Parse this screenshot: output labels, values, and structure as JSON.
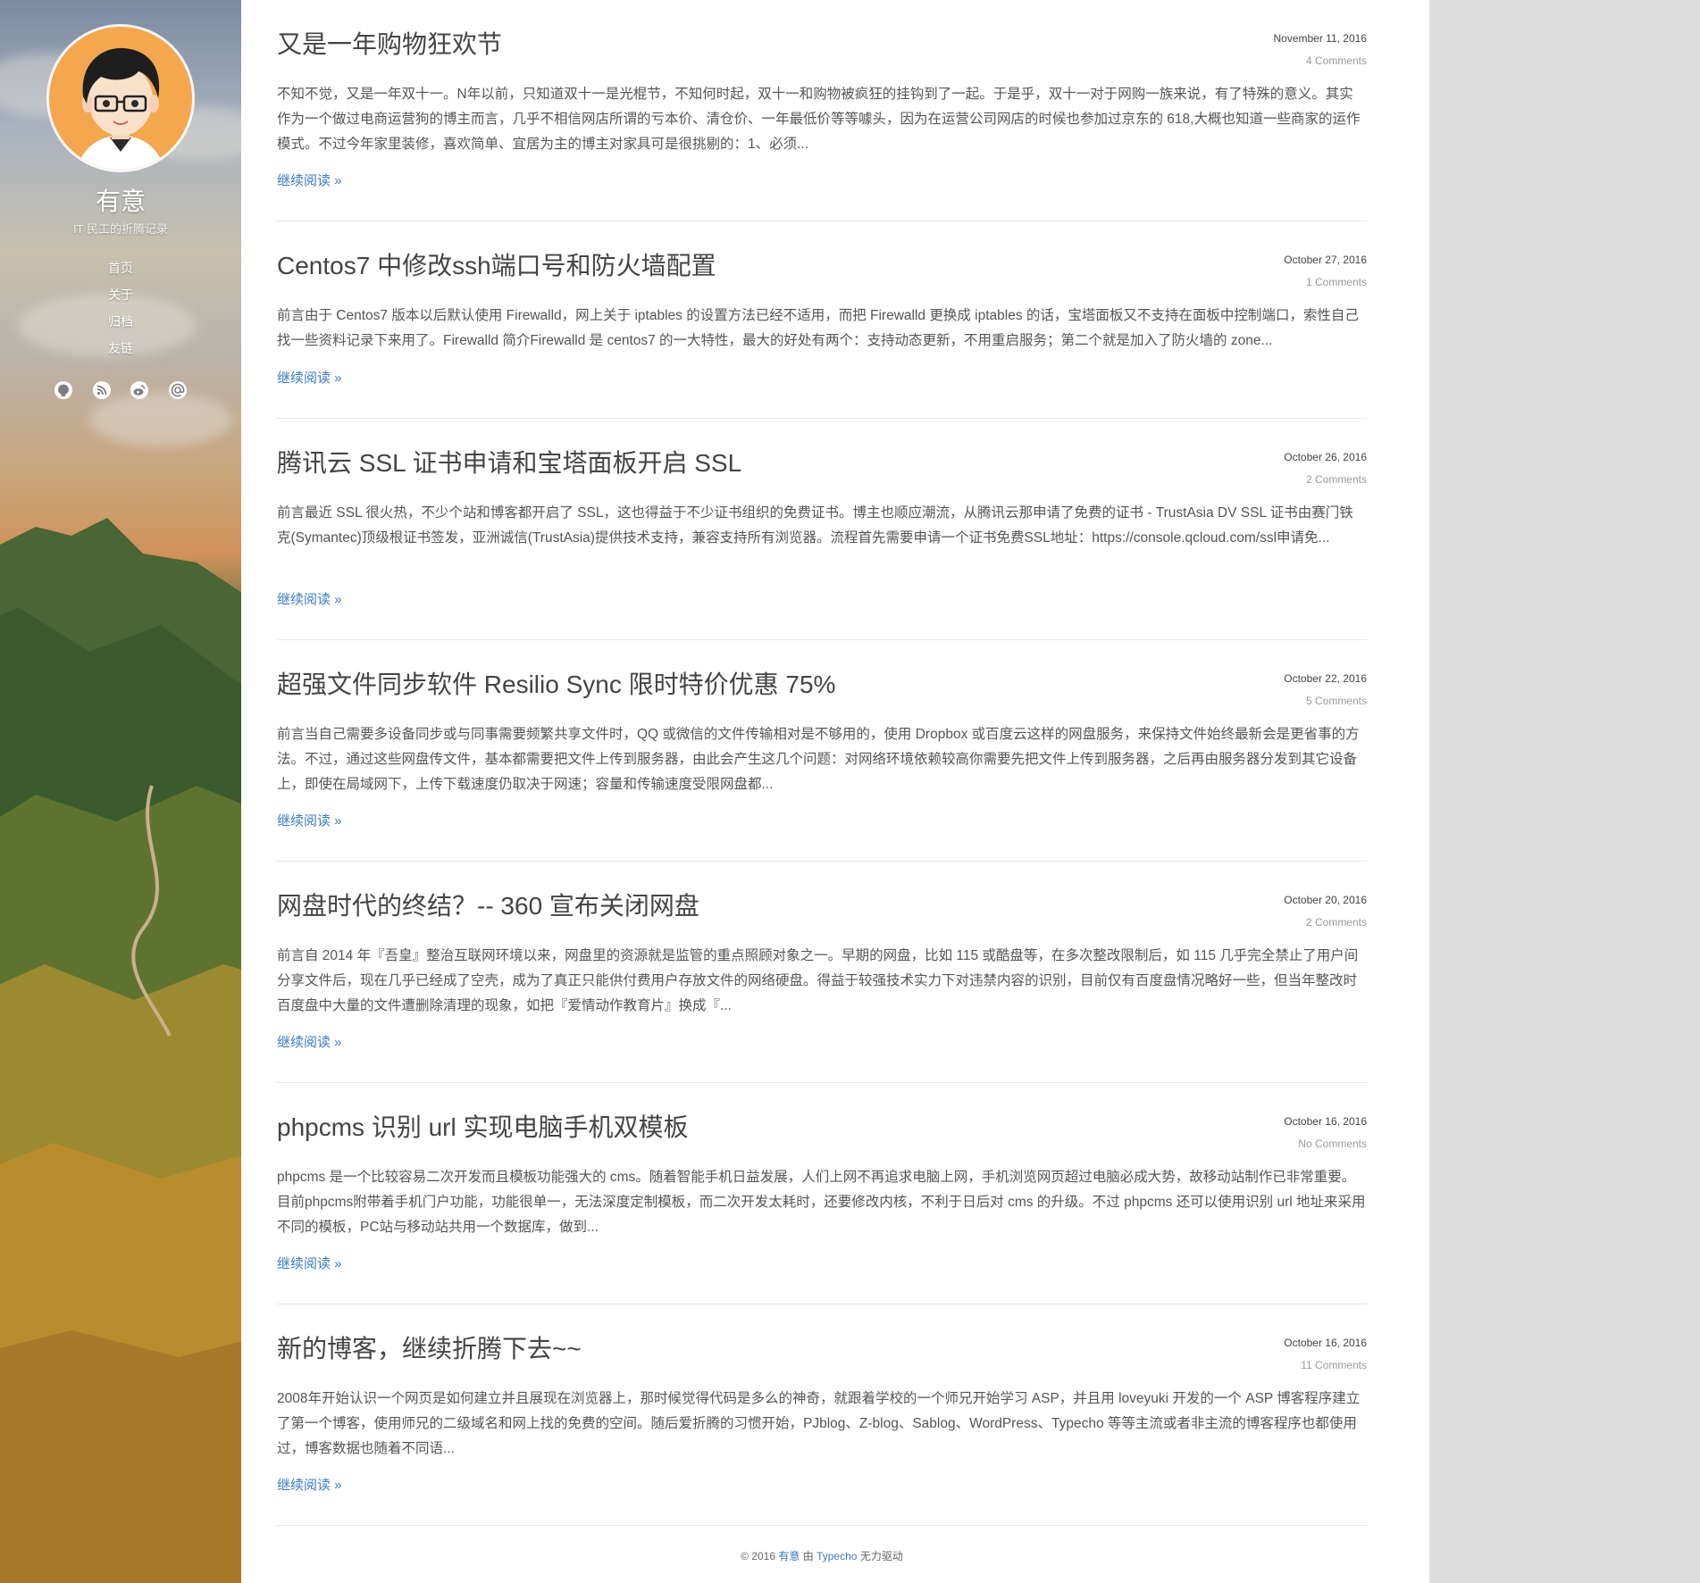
{
  "sidebar": {
    "site_title": "有意",
    "site_description": "IT 民工的折腾记录",
    "nav": [
      {
        "label": "首页"
      },
      {
        "label": "关于"
      },
      {
        "label": "归档"
      },
      {
        "label": "友链"
      }
    ],
    "social_icons": [
      "github-icon",
      "rss-icon",
      "weibo-icon",
      "email-icon"
    ]
  },
  "posts": [
    {
      "title": "又是一年购物狂欢节",
      "date": "November 11, 2016",
      "comments": "4 Comments",
      "excerpt": "不知不觉，又是一年双十一。N年以前，只知道双十一是光棍节，不知何时起，双十一和购物被疯狂的挂钩到了一起。于是乎，双十一对于网购一族来说，有了特殊的意义。其实作为一个做过电商运营狗的博主而言，几乎不相信网店所谓的亏本价、清仓价、一年最低价等等噱头，因为在运营公司网店的时候也参加过京东的 618,大概也知道一些商家的运作模式。不过今年家里装修，喜欢简单、宜居为主的博主对家具可是很挑剔的：1、必须...",
      "read_more": "继续阅读 »"
    },
    {
      "title": "Centos7 中修改ssh端口号和防火墙配置",
      "date": "October 27, 2016",
      "comments": "1 Comments",
      "excerpt": "前言由于 Centos7 版本以后默认使用 Firewalld，网上关于 iptables 的设置方法已经不适用，而把 Firewalld 更换成 iptables 的话，宝塔面板又不支持在面板中控制端口，索性自己找一些资料记录下来用了。Firewalld 简介Firewalld 是 centos7 的一大特性，最大的好处有两个：支持动态更新，不用重启服务；第二个就是加入了防火墙的 zone...",
      "read_more": "继续阅读 »"
    },
    {
      "title": "腾讯云 SSL 证书申请和宝塔面板开启 SSL",
      "date": "October 26, 2016",
      "comments": "2 Comments",
      "excerpt": "前言最近 SSL 很火热，不少个站和博客都开启了 SSL，这也得益于不少证书组织的免费证书。博主也顺应潮流，从腾讯云那申请了免费的证书 - TrustAsia DV SSL 证书由赛门铁克(Symantec)顶级根证书签发，亚洲诚信(TrustAsia)提供技术支持，兼容支持所有浏览器。流程首先需要申请一个证书免费SSL地址：https://console.qcloud.com/ssl申请免...",
      "read_more": "继续阅读 »"
    },
    {
      "title": "超强文件同步软件 Resilio Sync 限时特价优惠 75%",
      "date": "October 22, 2016",
      "comments": "5 Comments",
      "excerpt": "前言当自己需要多设备同步或与同事需要频繁共享文件时，QQ 或微信的文件传输相对是不够用的，使用 Dropbox 或百度云这样的网盘服务，来保持文件始终最新会是更省事的方法。不过，通过这些网盘传文件，基本都需要把文件上传到服务器，由此会产生这几个问题：对网络环境依赖较高你需要先把文件上传到服务器，之后再由服务器分发到其它设备上，即使在局域网下，上传下载速度仍取决于网速；容量和传输速度受限网盘都...",
      "read_more": "继续阅读 »"
    },
    {
      "title": "网盘时代的终结？-- 360 宣布关闭网盘",
      "date": "October 20, 2016",
      "comments": "2 Comments",
      "excerpt": "前言自 2014 年『吾皇』整治互联网环境以来，网盘里的资源就是监管的重点照顾对象之一。早期的网盘，比如 115 或酷盘等，在多次整改限制后，如 115 几乎完全禁止了用户间分享文件后，现在几乎已经成了空壳，成为了真正只能供付费用户存放文件的网络硬盘。得益于较强技术实力下对违禁内容的识别，目前仅有百度盘情况略好一些，但当年整改时百度盘中大量的文件遭删除清理的现象，如把『爱情动作教育片』换成『...",
      "read_more": "继续阅读 »"
    },
    {
      "title": "phpcms 识别 url 实现电脑手机双模板",
      "date": "October 16, 2016",
      "comments": "No Comments",
      "excerpt": "phpcms 是一个比较容易二次开发而且模板功能强大的 cms。随着智能手机日益发展，人们上网不再追求电脑上网，手机浏览网页超过电脑必成大势，故移动站制作已非常重要。目前phpcms附带着手机门户功能，功能很单一，无法深度定制模板，而二次开发太耗时，还要修改内核，不利于日后对 cms 的升级。不过 phpcms 还可以使用识别 url 地址来采用不同的模板，PC站与移动站共用一个数据库，做到...",
      "read_more": "继续阅读 »"
    },
    {
      "title": "新的博客，继续折腾下去~~",
      "date": "October 16, 2016",
      "comments": "11 Comments",
      "excerpt": "2008年开始认识一个网页是如何建立并且展现在浏览器上，那时候觉得代码是多么的神奇，就跟着学校的一个师兄开始学习 ASP，并且用 loveyuki 开发的一个 ASP 博客程序建立了第一个博客，使用师兄的二级域名和网上找的免费的空间。随后爱折腾的习惯开始，PJblog、Z-blog、Sablog、WordPress、Typecho 等等主流或者非主流的博客程序也都使用过，博客数据也随着不同语...",
      "read_more": "继续阅读 »"
    }
  ],
  "footer": {
    "prefix": "© 2016",
    "author": "有意",
    "by": "由",
    "engine": "Typecho",
    "suffix": "无力驱动"
  },
  "colors": {
    "link": "#3a7cc0",
    "title": "#444444",
    "text": "#555555",
    "right_gutter": "#dcdcdc"
  }
}
